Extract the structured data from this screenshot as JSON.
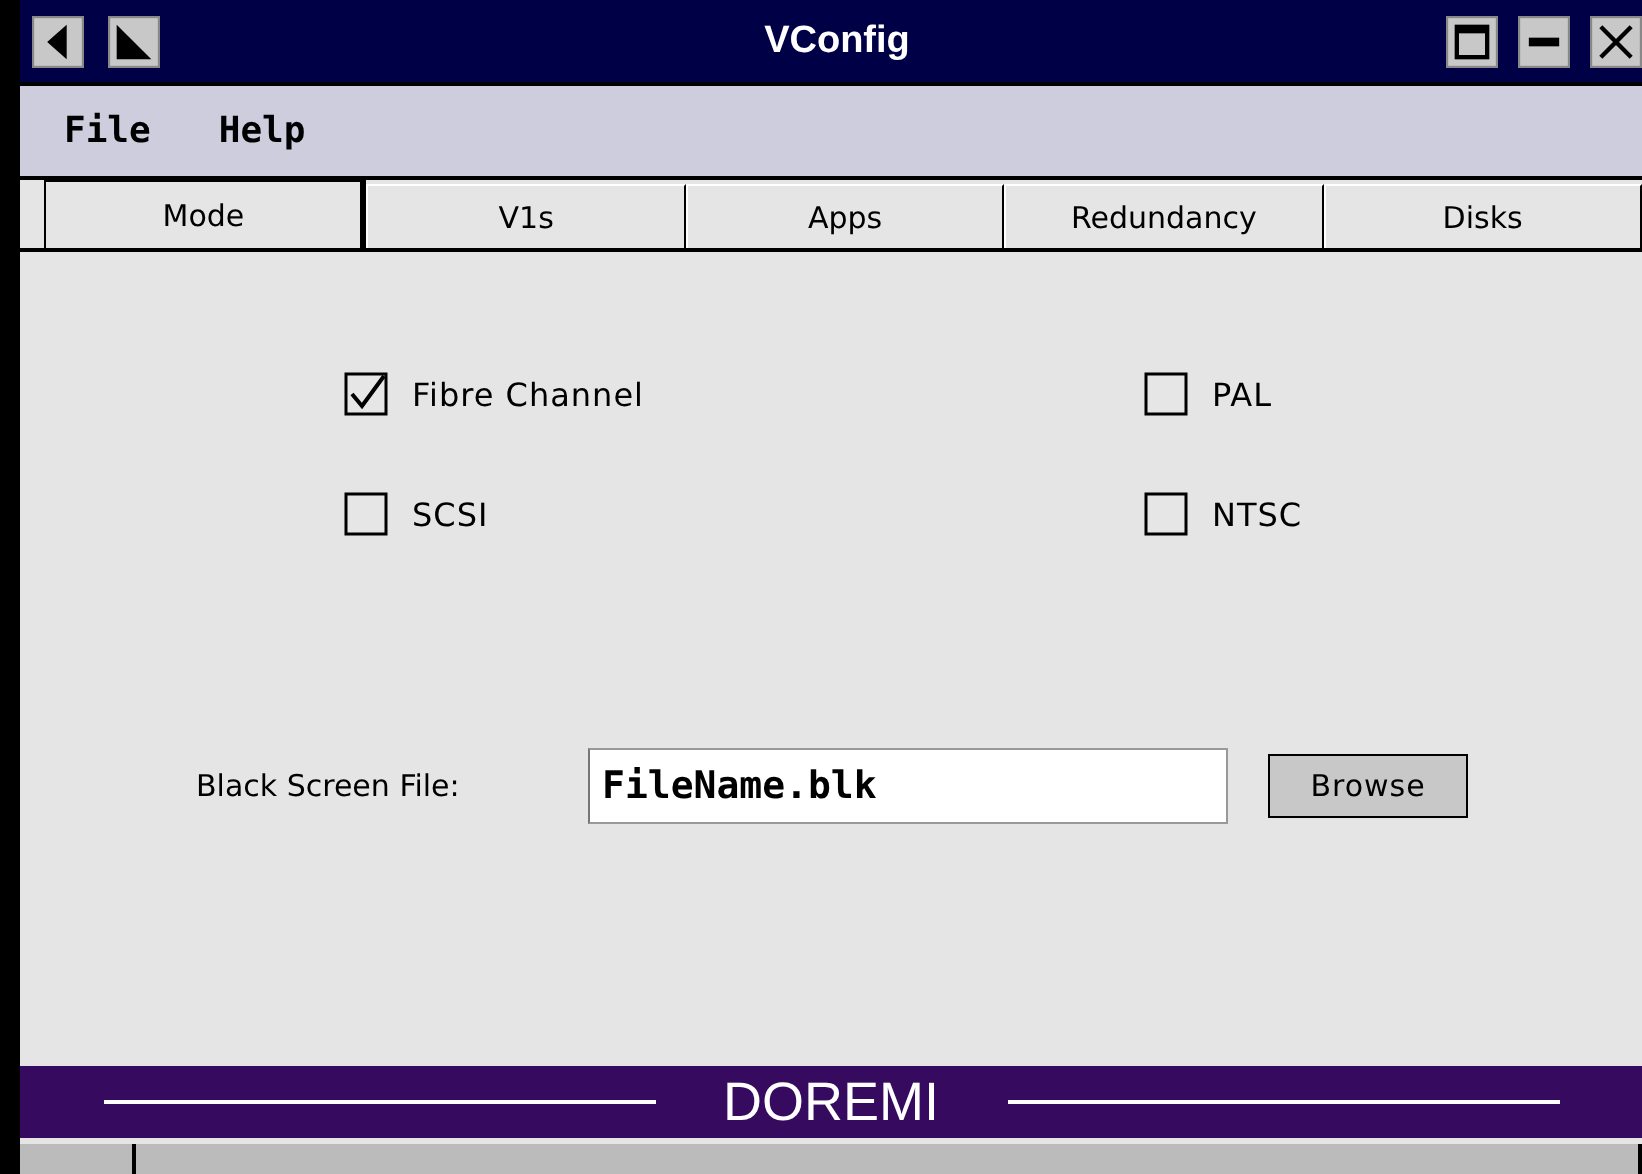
{
  "window": {
    "title": "VConfig"
  },
  "menu": [
    "File",
    "Help"
  ],
  "tabs": [
    {
      "label": "Mode",
      "selected": true
    },
    {
      "label": "V1s",
      "selected": false
    },
    {
      "label": "Apps",
      "selected": false
    },
    {
      "label": "Redundancy",
      "selected": false
    },
    {
      "label": "Disks",
      "selected": false
    }
  ],
  "options": [
    {
      "label": "Fibre Channel",
      "checked": true
    },
    {
      "label": "PAL",
      "checked": false
    },
    {
      "label": "SCSI",
      "checked": false
    },
    {
      "label": "NTSC",
      "checked": false
    }
  ],
  "black_screen_file": {
    "label": "Black Screen File:",
    "value": "FileName.blk",
    "button": "Browse"
  },
  "banner": {
    "text": "DOREMI"
  }
}
